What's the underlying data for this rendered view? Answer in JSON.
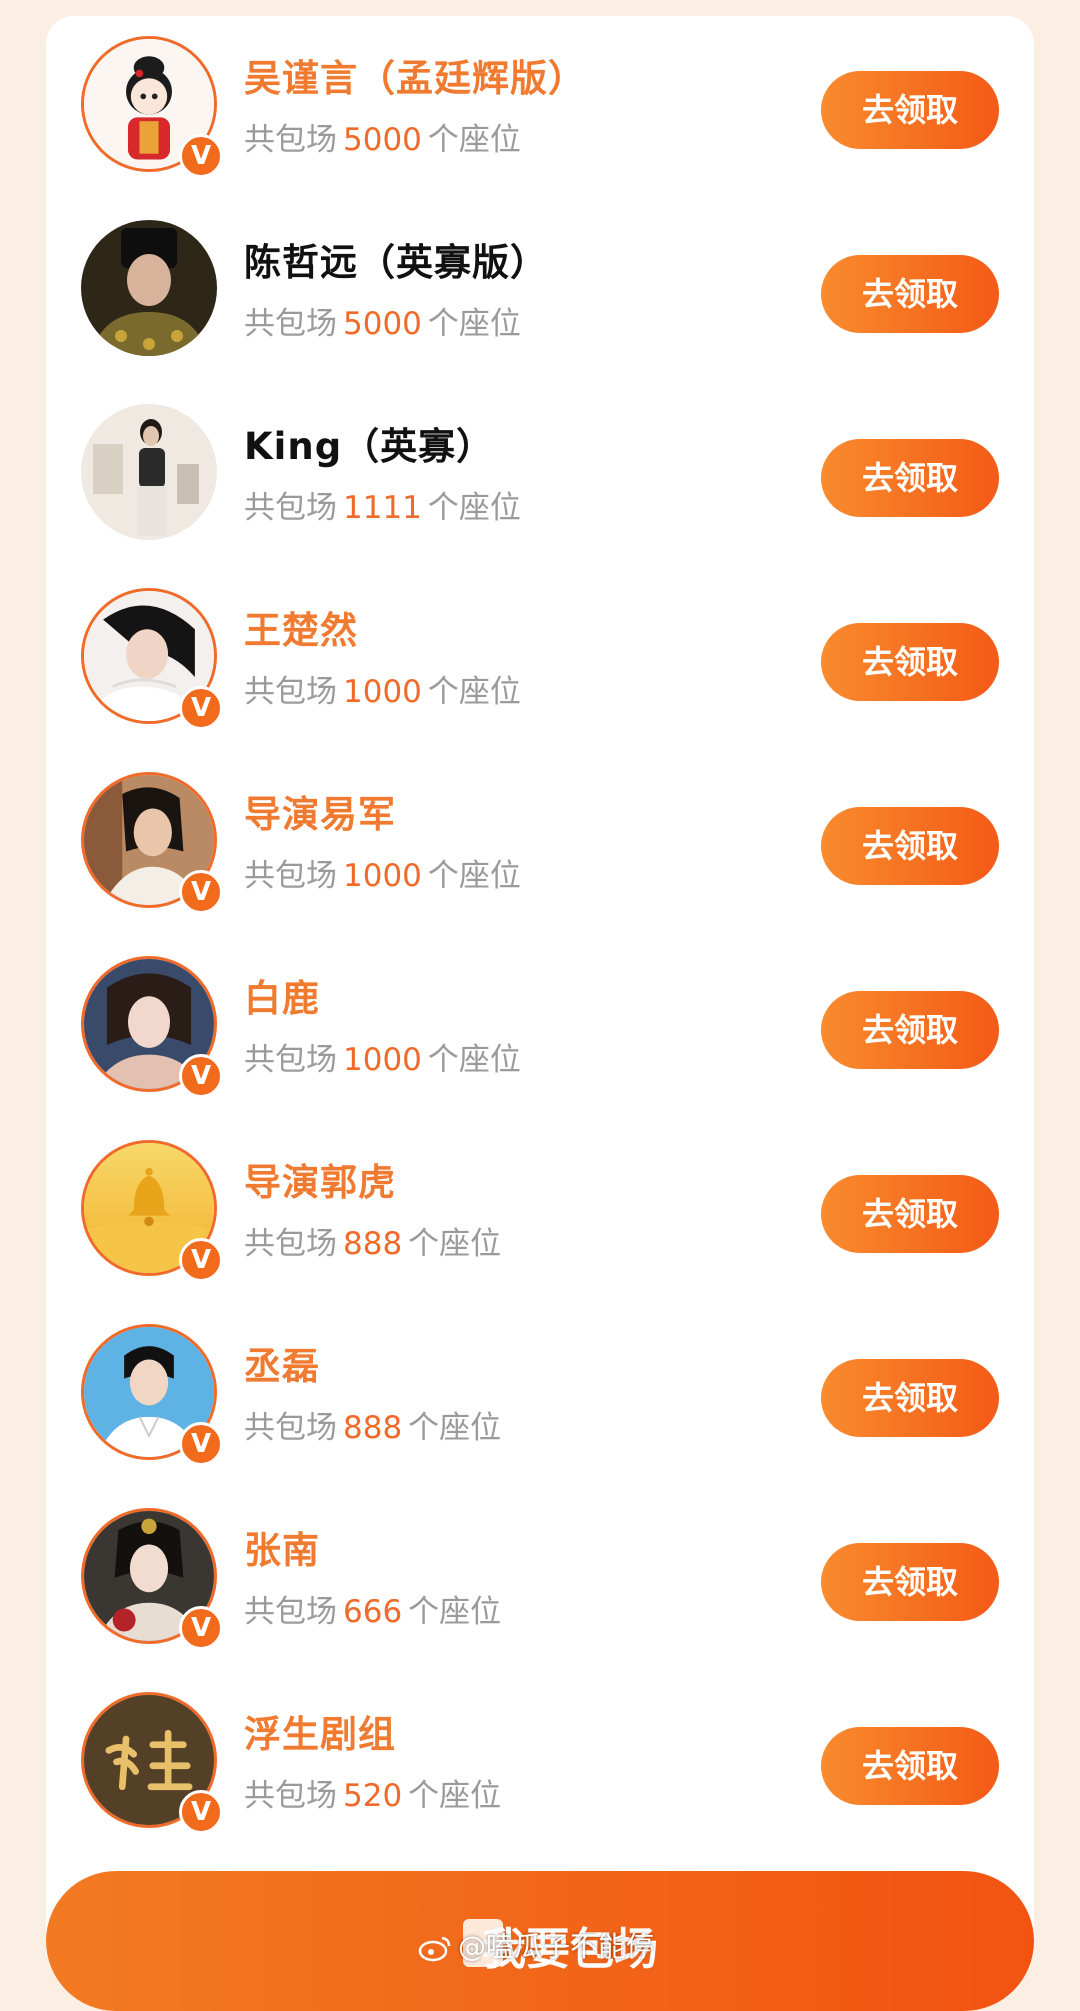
{
  "colors": {
    "accent": "#f06a2a",
    "name_orange": "#f07a30",
    "seat_gray": "#9a9a9a",
    "page_bg": "#fbeee2",
    "verified": "#f26b1d"
  },
  "list": [
    {
      "name": "吴谨言（孟廷辉版）",
      "name_color": "orange",
      "verified": true,
      "avatar_icon": "cartoon-avatar",
      "seats_prefix": "共包场",
      "seats": "5000",
      "seats_suffix": "个座位",
      "button": "去领取"
    },
    {
      "name": "陈哲远（英寡版）",
      "name_color": "black",
      "verified": false,
      "avatar_icon": "photo-avatar",
      "seats_prefix": "共包场",
      "seats": "5000",
      "seats_suffix": "个座位",
      "button": "去领取"
    },
    {
      "name": "King（英寡）",
      "name_color": "black",
      "verified": false,
      "avatar_icon": "photo-avatar",
      "seats_prefix": "共包场",
      "seats": "1111",
      "seats_suffix": "个座位",
      "button": "去领取"
    },
    {
      "name": "王楚然",
      "name_color": "orange",
      "verified": true,
      "avatar_icon": "photo-avatar",
      "seats_prefix": "共包场",
      "seats": "1000",
      "seats_suffix": "个座位",
      "button": "去领取"
    },
    {
      "name": "导演易军",
      "name_color": "orange",
      "verified": true,
      "avatar_icon": "photo-avatar",
      "seats_prefix": "共包场",
      "seats": "1000",
      "seats_suffix": "个座位",
      "button": "去领取"
    },
    {
      "name": "白鹿",
      "name_color": "orange",
      "verified": true,
      "avatar_icon": "photo-avatar",
      "seats_prefix": "共包场",
      "seats": "1000",
      "seats_suffix": "个座位",
      "button": "去领取"
    },
    {
      "name": "导演郭虎",
      "name_color": "orange",
      "verified": true,
      "avatar_icon": "bell-avatar",
      "seats_prefix": "共包场",
      "seats": "888",
      "seats_suffix": "个座位",
      "button": "去领取"
    },
    {
      "name": "丞磊",
      "name_color": "orange",
      "verified": true,
      "avatar_icon": "photo-avatar",
      "seats_prefix": "共包场",
      "seats": "888",
      "seats_suffix": "个座位",
      "button": "去领取"
    },
    {
      "name": "张南",
      "name_color": "orange",
      "verified": true,
      "avatar_icon": "photo-avatar",
      "seats_prefix": "共包场",
      "seats": "666",
      "seats_suffix": "个座位",
      "button": "去领取"
    },
    {
      "name": "浮生剧组",
      "name_color": "orange",
      "verified": true,
      "avatar_icon": "calligraphy-avatar",
      "seats_prefix": "共包场",
      "seats": "520",
      "seats_suffix": "个座位",
      "button": "去领取"
    }
  ],
  "verified_badge": "V",
  "footer_button": {
    "label": "我要包场",
    "icon": "ticket-icon"
  },
  "watermark": {
    "text": "@嗑瓜子不能停",
    "icon": "weibo-logo-icon"
  }
}
